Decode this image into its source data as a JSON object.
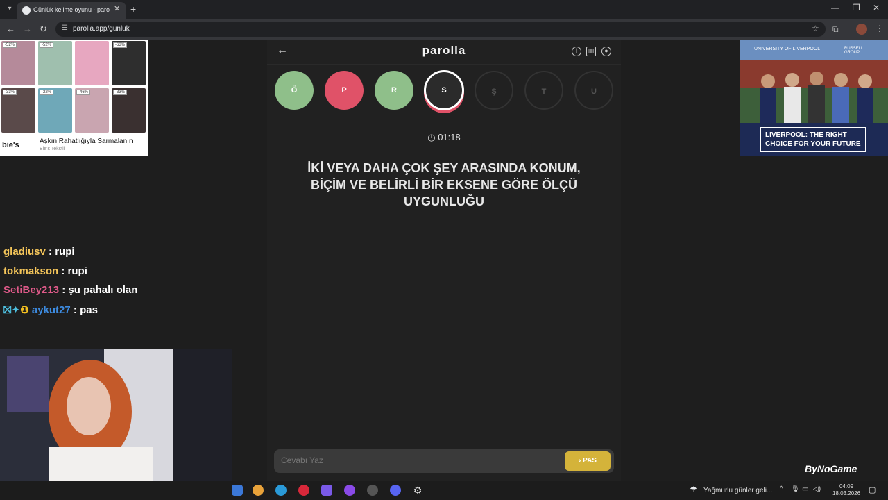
{
  "browser": {
    "tab_title": "Günlük kelime oyunu - parolla",
    "url": "parolla.app/gunluk"
  },
  "left_ad": {
    "discounts": [
      "-52%",
      "-52%",
      "-63%",
      "-33%",
      "-22%",
      "-46%",
      "-33%"
    ],
    "brand": "bie's",
    "tagline": "Aşkın Rahatlığıyla Sarmalanın",
    "subtext": "Bie's Tekstil"
  },
  "chat": [
    {
      "user": "gladiusv",
      "message": ": rupi",
      "color": "#f4c55a"
    },
    {
      "user": "tokmakson",
      "message": ": rupi",
      "color": "#f4c55a"
    },
    {
      "user": "SetiBey213",
      "message": ": şu pahalı olan",
      "color": "#e05a8a"
    },
    {
      "user": "aykut27",
      "message": ": pas",
      "color": "#3d8be0"
    }
  ],
  "game": {
    "logo": "parolla",
    "letters": [
      {
        "letter": "Ö",
        "state": "correct"
      },
      {
        "letter": "P",
        "state": "wrong"
      },
      {
        "letter": "R",
        "state": "correct"
      },
      {
        "letter": "S",
        "state": "active"
      },
      {
        "letter": "Ş",
        "state": "pending"
      },
      {
        "letter": "T",
        "state": "pending"
      },
      {
        "letter": "U",
        "state": "pending"
      }
    ],
    "timer": "01:18",
    "question": "İKİ VEYA DAHA ÇOK ŞEY ARASINDA KONUM, BİÇİM VE BELİRLİ BİR EKSENE GÖRE ÖLÇÜ UYGUNLUĞU",
    "answer_placeholder": "Cevabı Yaz",
    "pass_label": "PAS"
  },
  "right_ad": {
    "text": "LIVERPOOL: THE RIGHT CHOICE FOR YOUR FUTURE",
    "uni": "UNIVERSITY OF LIVERPOOL",
    "group": "RUSSELL GROUP"
  },
  "watermark": "ByNoGame",
  "taskbar": {
    "weather": "Yağmurlu günler geli...",
    "time": "04:09",
    "date": "18.03.2026"
  },
  "colors": {
    "correct": "#8fbf8a",
    "wrong": "#e05268",
    "pass": "#d4b33a"
  }
}
